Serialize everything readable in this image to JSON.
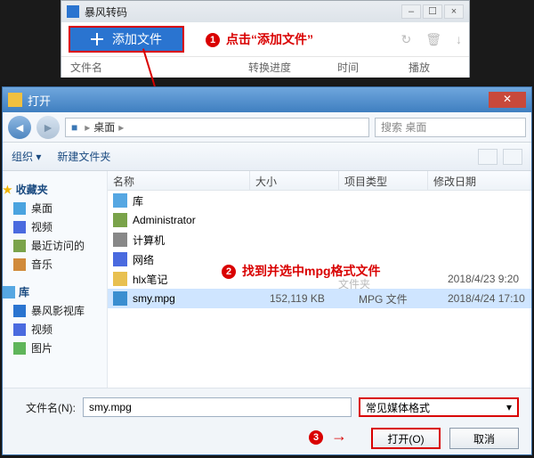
{
  "colors": {
    "accent": "#2a74d0",
    "annotation": "#d90000"
  },
  "app": {
    "title": "暴风转码",
    "add_button_label": "添加文件",
    "headers": {
      "filename": "文件名",
      "progress": "转换进度",
      "time": "时间",
      "play": "播放"
    },
    "icons": {
      "refresh": "↻",
      "trash": "🗑",
      "down": "↓"
    }
  },
  "annot": {
    "1": {
      "num": "1",
      "text": "点击“添加文件”"
    },
    "2": {
      "num": "2",
      "text": "找到并选中mpg格式文件"
    },
    "3": {
      "num": "3",
      "arrow": "→"
    },
    "shadow_type": "文件夹"
  },
  "dialog": {
    "title": "打开",
    "path_icon": "■",
    "path_label": "桌面",
    "path_sep": "▸",
    "search_placeholder": "搜索 桌面",
    "toolbar": {
      "organize": "组织 ▾",
      "newfolder": "新建文件夹"
    },
    "sidebar": {
      "fav": {
        "label": "收藏夹",
        "star": "★",
        "items": [
          "桌面",
          "视频",
          "最近访问的",
          "音乐"
        ]
      },
      "lib": {
        "label": "库",
        "items": [
          "暴风影视库",
          "视频",
          "图片"
        ]
      }
    },
    "columns": {
      "name": "名称",
      "size": "大小",
      "type": "项目类型",
      "date": "修改日期"
    },
    "rows": [
      {
        "name": "库",
        "size": "",
        "type": "",
        "date": ""
      },
      {
        "name": "Administrator",
        "size": "",
        "type": "",
        "date": ""
      },
      {
        "name": "计算机",
        "size": "",
        "type": "",
        "date": ""
      },
      {
        "name": "网络",
        "size": "",
        "type": "",
        "date": ""
      },
      {
        "name": "hlx笔记",
        "size": "",
        "type": "",
        "date": "2018/4/23 9:20"
      },
      {
        "name": "smy.mpg",
        "size": "152,119 KB",
        "type": "MPG 文件",
        "date": "2018/4/24 17:10"
      }
    ],
    "selected_index": 5,
    "footer": {
      "filename_label": "文件名(N):",
      "filename_value": "smy.mpg",
      "filter_label": "常见媒体格式",
      "open": "打开(O)",
      "cancel": "取消"
    }
  }
}
